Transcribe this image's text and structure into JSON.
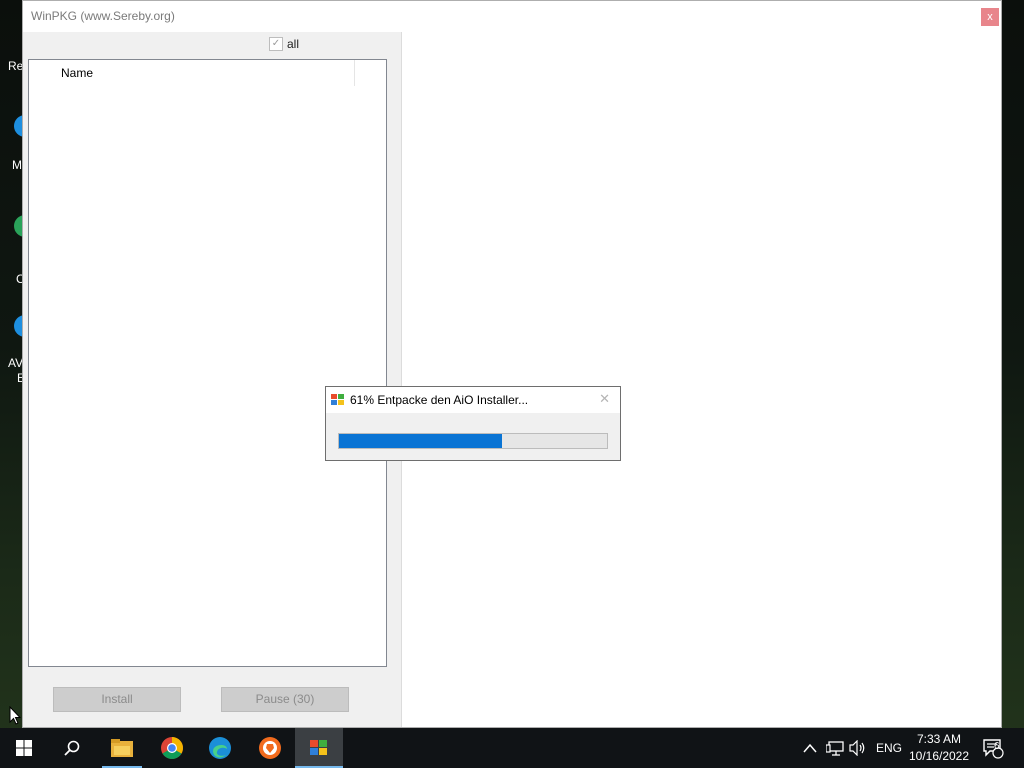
{
  "desktop": {
    "icon_labels": [
      "Re",
      "M",
      "C",
      "AV",
      "E"
    ]
  },
  "window": {
    "title": "WinPKG (www.Sereby.org)",
    "close_glyph": "x",
    "all_checkbox": {
      "label": "all",
      "checked": true
    },
    "list": {
      "column_name": "Name"
    },
    "buttons": {
      "install": "Install",
      "pause": "Pause (30)"
    }
  },
  "dialog": {
    "title": "61% Entpacke den AiO Installer...",
    "progress_percent": 61,
    "close_glyph": "✕"
  },
  "taskbar": {
    "apps": [
      "start-icon",
      "search-icon",
      "file-explorer-icon",
      "chrome-icon",
      "edge-icon",
      "brave-icon",
      "winpkg-icon"
    ],
    "tray": {
      "language": "ENG",
      "time": "7:33 AM",
      "date": "10/16/2022",
      "notification_count": "6"
    }
  },
  "colors": {
    "accent": "#0a74d4",
    "taskbar": "#101316"
  }
}
